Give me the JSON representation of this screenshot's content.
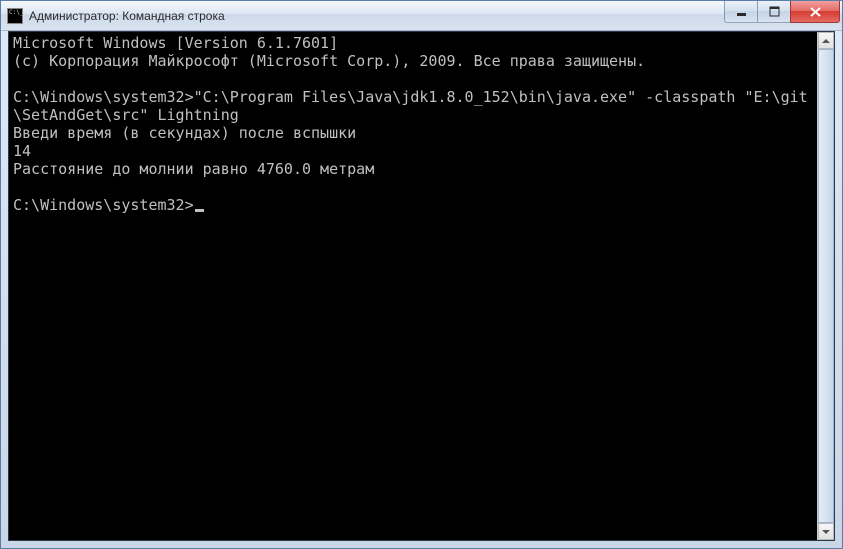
{
  "window": {
    "title": "Администратор: Командная строка"
  },
  "terminal": {
    "line1": "Microsoft Windows [Version 6.1.7601]",
    "line2": "(c) Корпорация Майкрософт (Microsoft Corp.), 2009. Все права защищены.",
    "blank1": "",
    "line3": "C:\\Windows\\system32>\"C:\\Program Files\\Java\\jdk1.8.0_152\\bin\\java.exe\" -classpath \"E:\\git\\SetAndGet\\src\" Lightning",
    "line4": "Введи время (в секундах) после вспышки",
    "line5": "14",
    "line6": "Расстояние до молнии равно 4760.0 метрам",
    "blank2": "",
    "prompt": "C:\\Windows\\system32>"
  }
}
